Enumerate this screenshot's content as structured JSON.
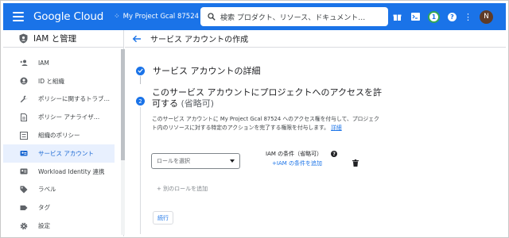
{
  "topbar": {
    "logo": "Google Cloud",
    "project": "My Project Gcal 87524",
    "search_text": "検索  プロダクト、リソース、ドキュメント…",
    "notification_count": "1",
    "help": "?",
    "avatar": "N",
    "accent": "#1a73e8"
  },
  "sidebar": {
    "title": "IAM と管理",
    "items": [
      {
        "label": "IAM",
        "icon": "person-add-icon"
      },
      {
        "label": "ID と組織",
        "icon": "account-circle-icon"
      },
      {
        "label": "ポリシーに関するトラブ…",
        "icon": "wrench-icon"
      },
      {
        "label": "ポリシー アナライザ…",
        "icon": "document-icon"
      },
      {
        "label": "組織のポリシー",
        "icon": "list-icon"
      },
      {
        "label": "サービス アカウント",
        "icon": "service-account-icon",
        "active": true
      },
      {
        "label": "Workload Identity 連携",
        "icon": "id-card-icon"
      },
      {
        "label": "ラベル",
        "icon": "label-icon"
      },
      {
        "label": "タグ",
        "icon": "tag-icon"
      },
      {
        "label": "設定",
        "icon": "gear-icon"
      }
    ]
  },
  "main": {
    "page_title": "サービス アカウントの作成",
    "step1_title": "サービス アカウントの詳細",
    "step2_number": "2",
    "step2_title": "このサービス アカウントにプロジェクトへのアクセスを許可する",
    "step2_optional": "(省略可)",
    "description": "このサービス アカウントに My Project Gcal 87524 へのアクセス権を付与して、プロジェクト内のリソースに対する特定のアクションを完了する権限を付与します。",
    "details_link": "詳細",
    "role_placeholder": "ロールを選択",
    "condition_label": "IAM の条件（省略可）",
    "add_condition": "IAM の条件を追加",
    "add_role": "別のロールを追加",
    "continue": "続行"
  }
}
